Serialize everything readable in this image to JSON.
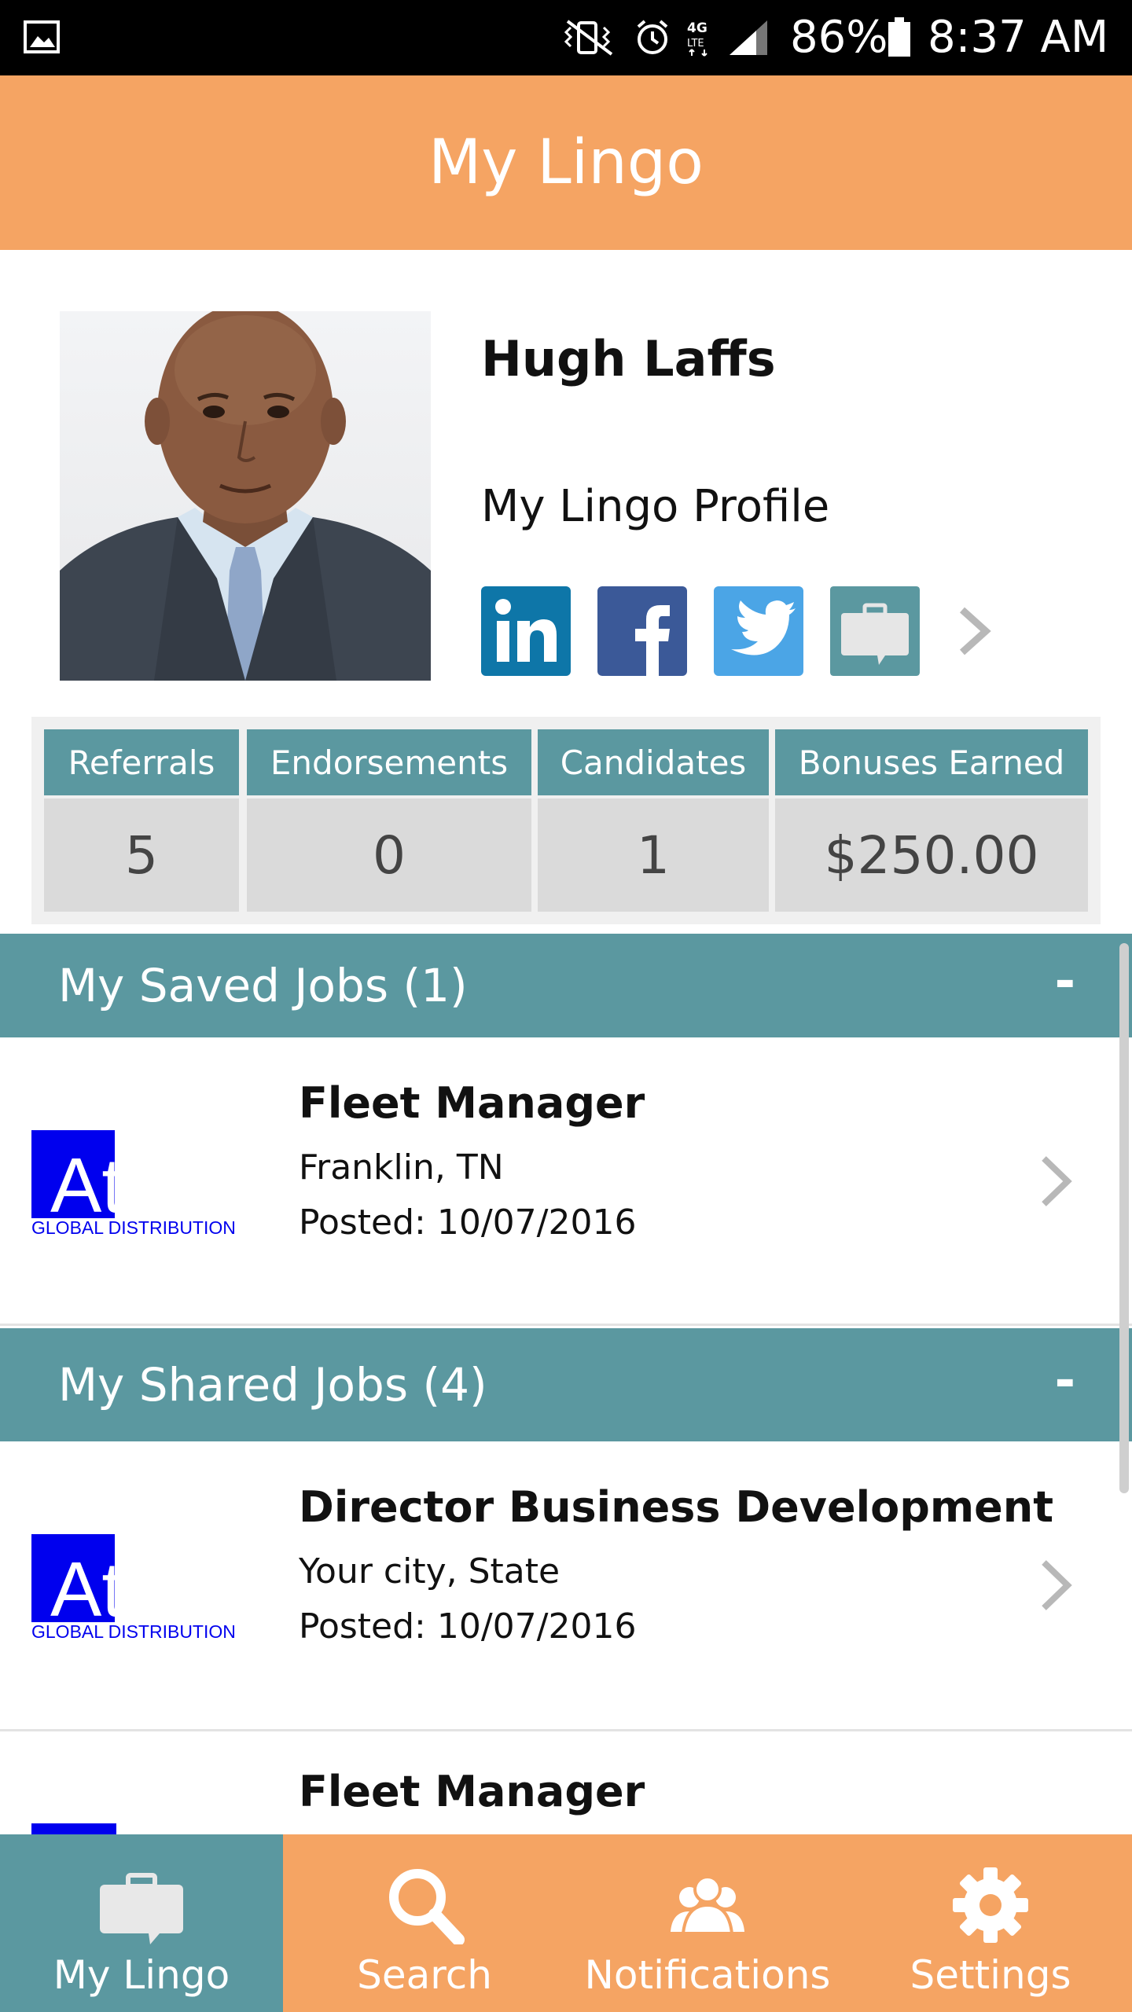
{
  "status_bar": {
    "battery_pct": "86%",
    "time": "8:37 AM",
    "network": "4G LTE"
  },
  "header": {
    "title": "My Lingo"
  },
  "profile": {
    "name": "Hugh Laffs",
    "link_text": "My Lingo Profile",
    "social": [
      "linkedin-icon",
      "facebook-icon",
      "twitter-icon",
      "briefcase-icon"
    ]
  },
  "stats": [
    {
      "label": "Referrals",
      "value": "5"
    },
    {
      "label": "Endorsements",
      "value": "0"
    },
    {
      "label": "Candidates",
      "value": "1"
    },
    {
      "label": "Bonuses Earned",
      "value": "$250.00"
    }
  ],
  "saved_jobs": {
    "title": "My Saved Jobs (1)",
    "toggle": "-",
    "items": [
      {
        "logo_word": "Atlas",
        "logo_tag": "GLOBAL DISTRIBUTION",
        "title": "Fleet Manager",
        "location": "Franklin, TN",
        "posted": "Posted: 10/07/2016"
      }
    ]
  },
  "shared_jobs": {
    "title": "My Shared Jobs (4)",
    "toggle": "-",
    "items": [
      {
        "logo_word": "Atlas",
        "logo_tag": "GLOBAL DISTRIBUTION",
        "title": "Director Business Development",
        "location": "Your city, State",
        "posted": "Posted: 10/07/2016"
      },
      {
        "title": "Fleet Manager"
      }
    ]
  },
  "bottom_nav": [
    {
      "label": "My Lingo",
      "icon": "briefcase-icon",
      "active": true
    },
    {
      "label": "Search",
      "icon": "search-icon",
      "active": false
    },
    {
      "label": "Notifications",
      "icon": "people-icon",
      "active": false
    },
    {
      "label": "Settings",
      "icon": "gear-icon",
      "active": false
    }
  ],
  "colors": {
    "accent_orange": "#f5a463",
    "accent_teal": "#5b98a0",
    "logo_blue": "#0000ee"
  }
}
